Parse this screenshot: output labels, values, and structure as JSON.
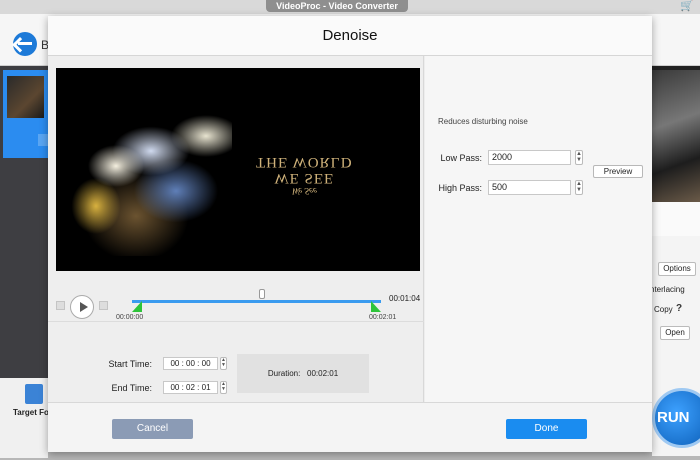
{
  "window": {
    "title": "VideoProc - Video Converter"
  },
  "appbar": {
    "back_label": "B"
  },
  "left_panel": {
    "target_label": "Target For"
  },
  "right_panel": {
    "options_label": "Options",
    "interlacing_label": "nterlacing",
    "copy_label": "Copy",
    "open_label": "Open",
    "run_label": "RUN"
  },
  "modal": {
    "title": "Denoise",
    "timeline": {
      "start_marker": "00:00:00",
      "end_marker": "00:02:01",
      "current_time": "00:01:04"
    },
    "video_overlay": {
      "line1": "We See",
      "line2": "WE SEE",
      "line3": "THE WORLD"
    },
    "start_time": {
      "label": "Start Time:",
      "value": "00 : 00 : 00"
    },
    "end_time": {
      "label": "End Time:",
      "value": "00 : 02 : 01"
    },
    "duration": {
      "label": "Duration:",
      "value": "00:02:01"
    },
    "settings": {
      "description": "Reduces disturbing noise",
      "low_pass": {
        "label": "Low Pass:",
        "value": "2000"
      },
      "high_pass": {
        "label": "High Pass:",
        "value": "500"
      },
      "preview_label": "Preview"
    },
    "footer": {
      "cancel_label": "Cancel",
      "done_label": "Done"
    }
  },
  "colors": {
    "accent": "#1a8cf0",
    "trim_handle": "#2ec43a",
    "cancel": "#8b9bb5"
  }
}
